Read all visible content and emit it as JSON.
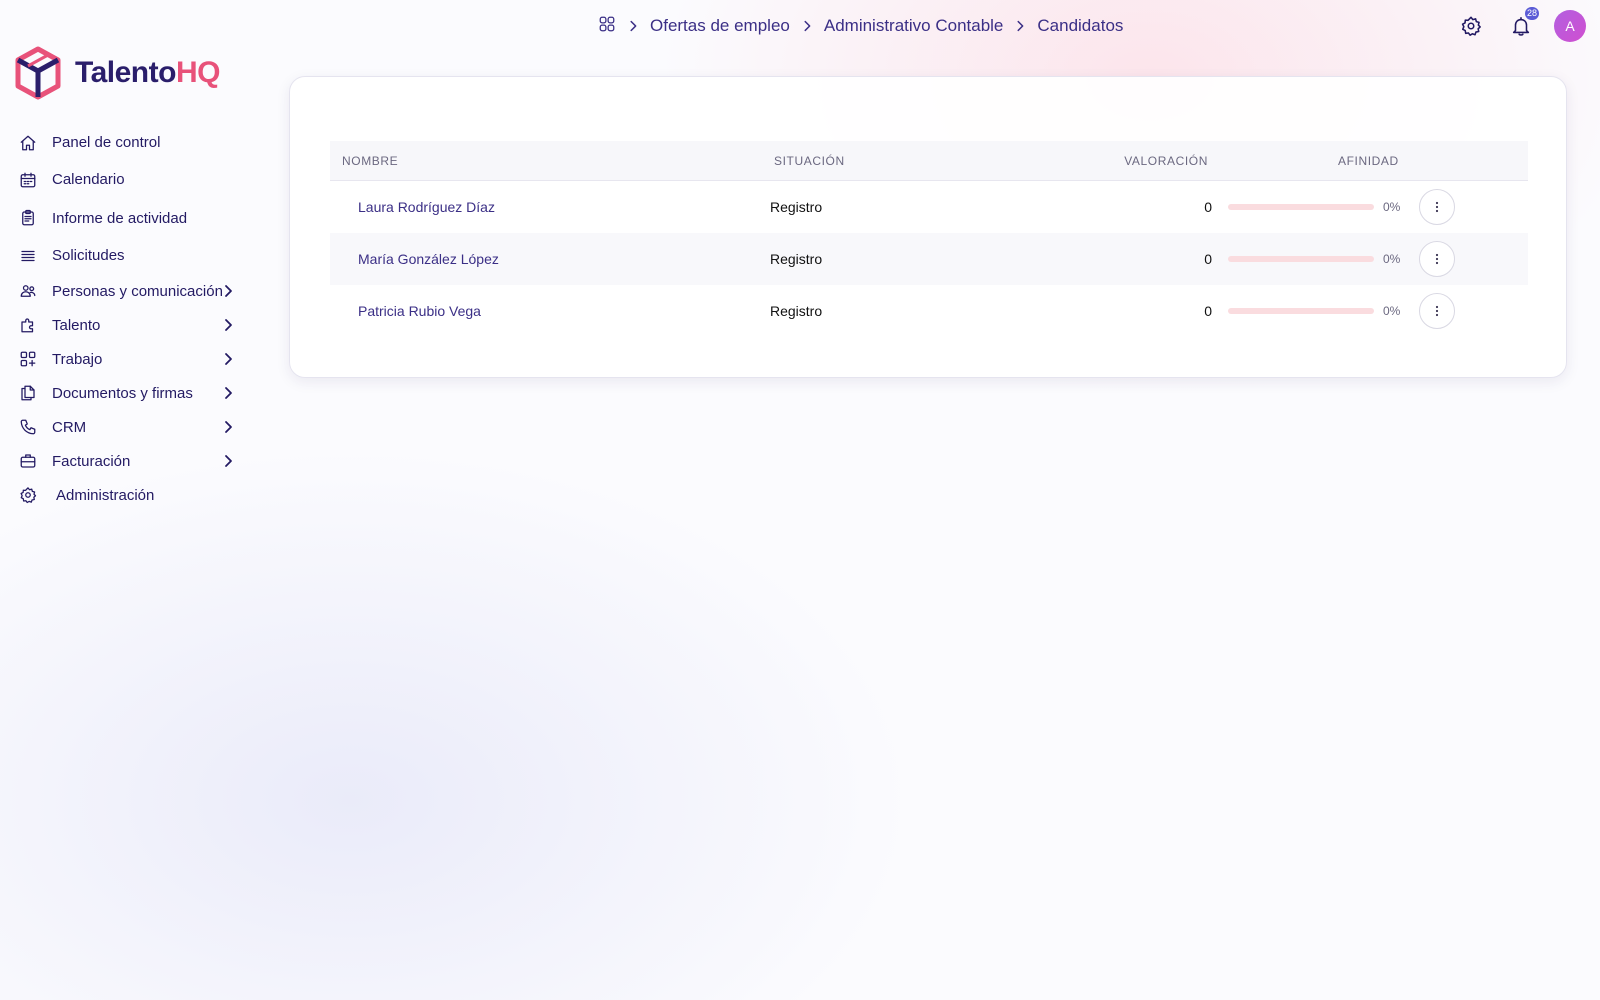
{
  "brand": {
    "name_part1": "Talento",
    "name_part2": "HQ",
    "logo_colors": [
      "#e8527a",
      "#2a1e6b"
    ]
  },
  "sidebar": {
    "items": [
      {
        "label": "Panel de control",
        "icon": "home-icon",
        "has_submenu": false
      },
      {
        "label": "Calendario",
        "icon": "calendar-icon",
        "has_submenu": false
      },
      {
        "label": "Informe de actividad",
        "icon": "clipboard-icon",
        "has_submenu": false
      },
      {
        "label": "Solicitudes",
        "icon": "list-icon",
        "has_submenu": false
      },
      {
        "label": "Personas y comunicación",
        "icon": "users-icon",
        "has_submenu": true
      },
      {
        "label": "Talento",
        "icon": "puzzle-icon",
        "has_submenu": true
      },
      {
        "label": "Trabajo",
        "icon": "grid-plus-icon",
        "has_submenu": true
      },
      {
        "label": "Documentos y firmas",
        "icon": "documents-icon",
        "has_submenu": true
      },
      {
        "label": "CRM",
        "icon": "phone-icon",
        "has_submenu": true
      },
      {
        "label": "Facturación",
        "icon": "briefcase-icon",
        "has_submenu": true
      },
      {
        "label": "Administración",
        "icon": "gear-icon",
        "has_submenu": false
      }
    ]
  },
  "breadcrumb": {
    "home_icon": "apps-icon",
    "items": [
      "Ofertas de empleo",
      "Administrativo Contable",
      "Candidatos"
    ]
  },
  "topbar": {
    "settings_icon": "gear-icon",
    "notifications_icon": "bell-icon",
    "notification_count": "28",
    "avatar_initial": "A"
  },
  "table": {
    "columns": {
      "name": "NOMBRE",
      "status": "SITUACIÓN",
      "rating": "VALORACIÓN",
      "affinity": "AFINIDAD"
    },
    "rows": [
      {
        "name": "Laura Rodríguez Díaz",
        "status": "Registro",
        "rating": "0",
        "affinity": 0,
        "affinity_label": "0%"
      },
      {
        "name": "María González López",
        "status": "Registro",
        "rating": "0",
        "affinity": 0,
        "affinity_label": "0%"
      },
      {
        "name": "Patricia Rubio Vega",
        "status": "Registro",
        "rating": "0",
        "affinity": 0,
        "affinity_label": "0%"
      }
    ]
  },
  "colors": {
    "accent": "#e8527a",
    "primary": "#2a1e6b",
    "link": "#3b2f86",
    "badge": "#5b5bd6"
  }
}
